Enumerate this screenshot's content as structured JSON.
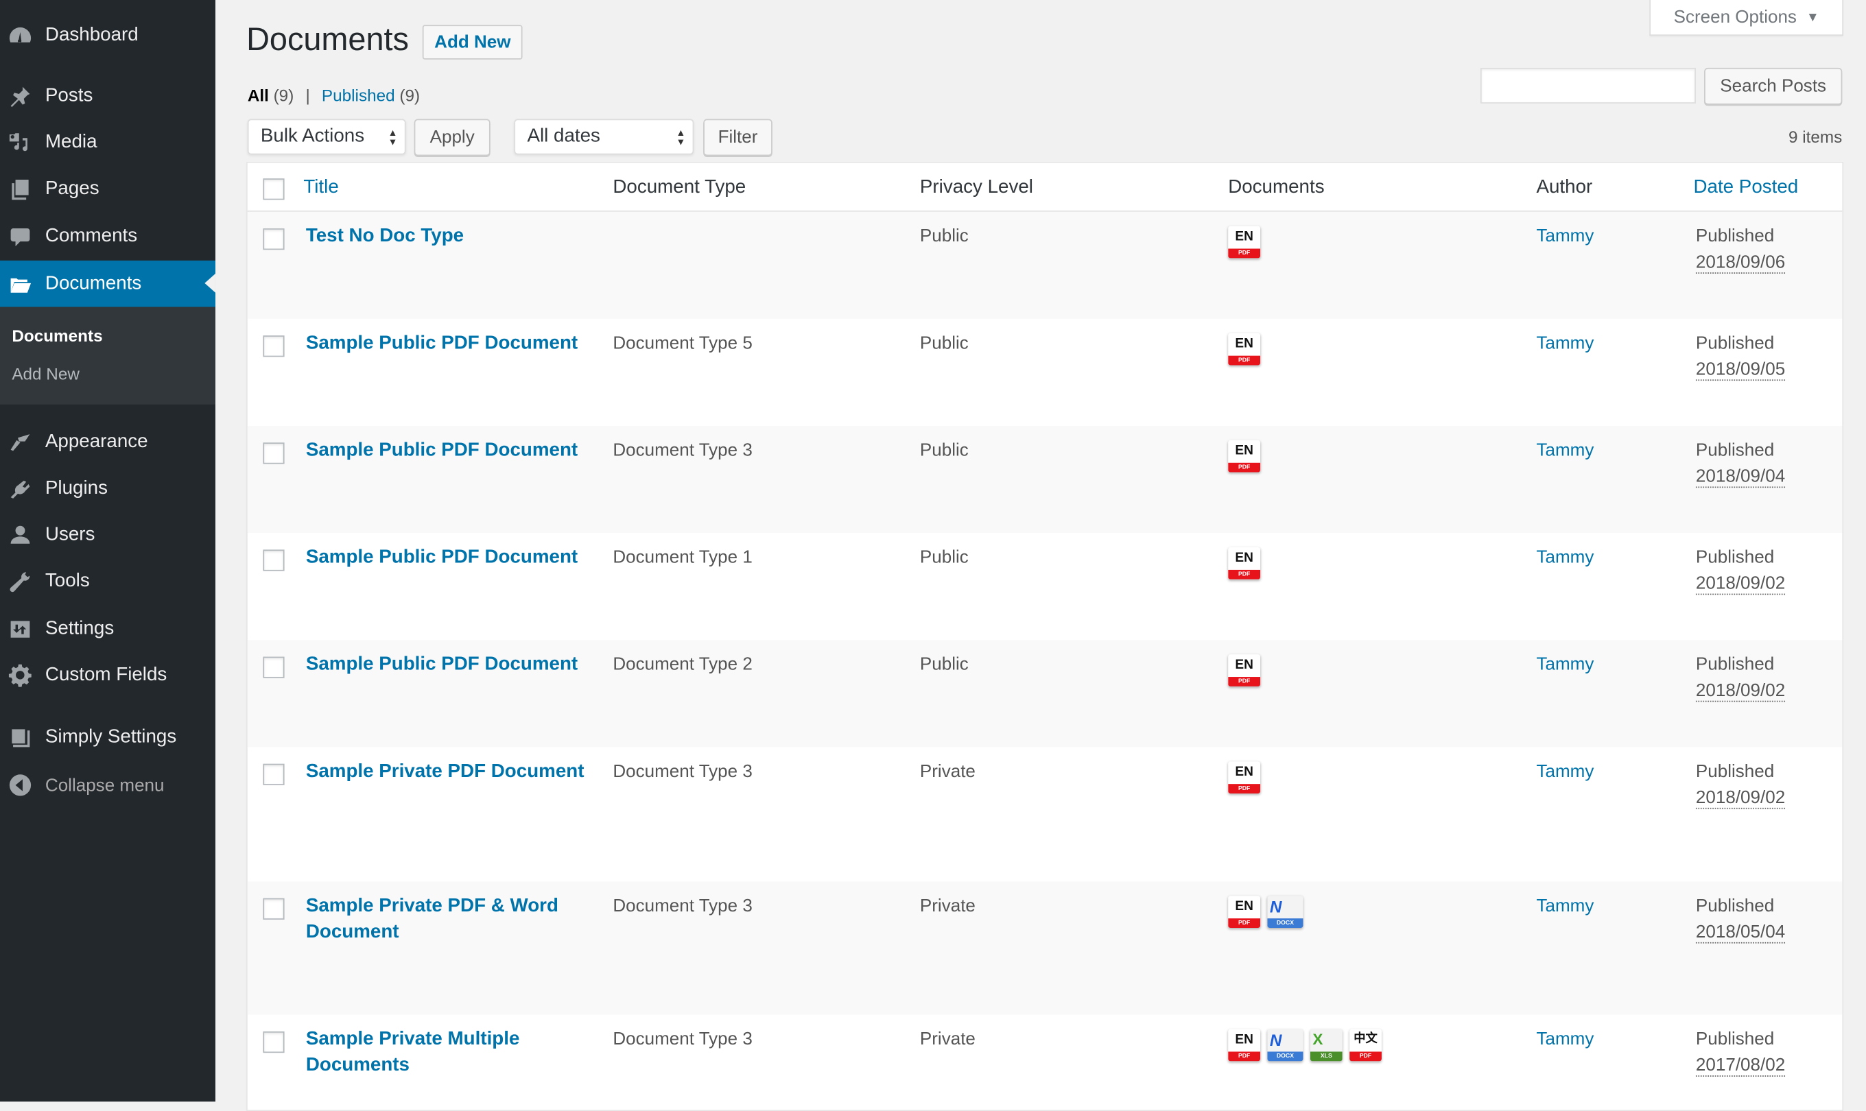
{
  "sidebar": {
    "items": [
      {
        "label": "Dashboard",
        "icon": "dashboard-icon"
      },
      {
        "label": "Posts",
        "icon": "pushpin-icon"
      },
      {
        "label": "Media",
        "icon": "media-icon"
      },
      {
        "label": "Pages",
        "icon": "pages-icon"
      },
      {
        "label": "Comments",
        "icon": "comment-icon"
      },
      {
        "label": "Documents",
        "icon": "folder-open-icon",
        "active": true
      },
      {
        "label": "Appearance",
        "icon": "paintbrush-icon"
      },
      {
        "label": "Plugins",
        "icon": "plugin-icon"
      },
      {
        "label": "Users",
        "icon": "user-icon"
      },
      {
        "label": "Tools",
        "icon": "wrench-icon"
      },
      {
        "label": "Settings",
        "icon": "settings-icon"
      },
      {
        "label": "Custom Fields",
        "icon": "gear-icon"
      },
      {
        "label": "Simply Settings",
        "icon": "book-icon"
      },
      {
        "label": "Collapse menu",
        "icon": "collapse-arrow-icon"
      }
    ],
    "submenu": [
      {
        "label": "Documents",
        "current": true
      },
      {
        "label": "Add New"
      }
    ]
  },
  "header": {
    "screen_options": "Screen Options",
    "title": "Documents",
    "add_new": "Add New"
  },
  "views": {
    "all_label": "All",
    "all_count": "(9)",
    "separator": "|",
    "published_label": "Published",
    "published_count": "(9)"
  },
  "search": {
    "value": "",
    "placeholder": "",
    "button": "Search Posts"
  },
  "tablenav": {
    "bulk_actions": "Bulk Actions",
    "apply": "Apply",
    "dates": "All dates",
    "filter": "Filter",
    "items_count": "9 items"
  },
  "table": {
    "columns": [
      "Title",
      "Document Type",
      "Privacy Level",
      "Documents",
      "Author",
      "Date Posted"
    ],
    "rows": [
      {
        "title": "Test No Doc Type",
        "type": "",
        "privacy": "Public",
        "documents": [
          "pdf-en"
        ],
        "author": "Tammy",
        "status": "Published",
        "date": "2018/09/06"
      },
      {
        "title": "Sample Public PDF Document",
        "type": "Document Type 5",
        "privacy": "Public",
        "documents": [
          "pdf-en"
        ],
        "author": "Tammy",
        "status": "Published",
        "date": "2018/09/05"
      },
      {
        "title": "Sample Public PDF Document",
        "type": "Document Type 3",
        "privacy": "Public",
        "documents": [
          "pdf-en"
        ],
        "author": "Tammy",
        "status": "Published",
        "date": "2018/09/04"
      },
      {
        "title": "Sample Public PDF Document",
        "type": "Document Type 1",
        "privacy": "Public",
        "documents": [
          "pdf-en"
        ],
        "author": "Tammy",
        "status": "Published",
        "date": "2018/09/02"
      },
      {
        "title": "Sample Public PDF Document",
        "type": "Document Type 2",
        "privacy": "Public",
        "documents": [
          "pdf-en"
        ],
        "author": "Tammy",
        "status": "Published",
        "date": "2018/09/02"
      },
      {
        "title": "Sample Private PDF Document",
        "type": "Document Type 3",
        "privacy": "Private",
        "documents": [
          "pdf-en"
        ],
        "author": "Tammy",
        "status": "Published",
        "date": "2018/09/02"
      },
      {
        "title": "Sample Private PDF & Word Document",
        "type": "Document Type 3",
        "privacy": "Private",
        "documents": [
          "pdf-en",
          "docx"
        ],
        "author": "Tammy",
        "status": "Published",
        "date": "2018/05/04"
      },
      {
        "title": "Sample Private Multiple Documents",
        "type": "Document Type 3",
        "privacy": "Private",
        "documents": [
          "pdf-en",
          "docx",
          "xls",
          "pdf-zh"
        ],
        "author": "Tammy",
        "status": "Published",
        "date": "2017/08/02"
      }
    ]
  },
  "doc_icons": {
    "pdf-en": {
      "glyph": "EN",
      "band": "PDF",
      "name": "pdf-english-icon",
      "cls": "pdf"
    },
    "pdf-zh": {
      "glyph": "中文",
      "band": "PDF",
      "name": "pdf-chinese-icon",
      "cls": "pdf zh"
    },
    "docx": {
      "glyph": "N",
      "band": "DOCX",
      "name": "word-docx-icon",
      "cls": "docx"
    },
    "xls": {
      "glyph": "X",
      "band": "XLS",
      "name": "excel-xls-icon",
      "cls": "xls"
    }
  },
  "colors": {
    "sidebar_bg": "#23282d",
    "accent": "#0073aa",
    "submenu_bg": "#32373c",
    "page_bg": "#f1f1f1"
  }
}
